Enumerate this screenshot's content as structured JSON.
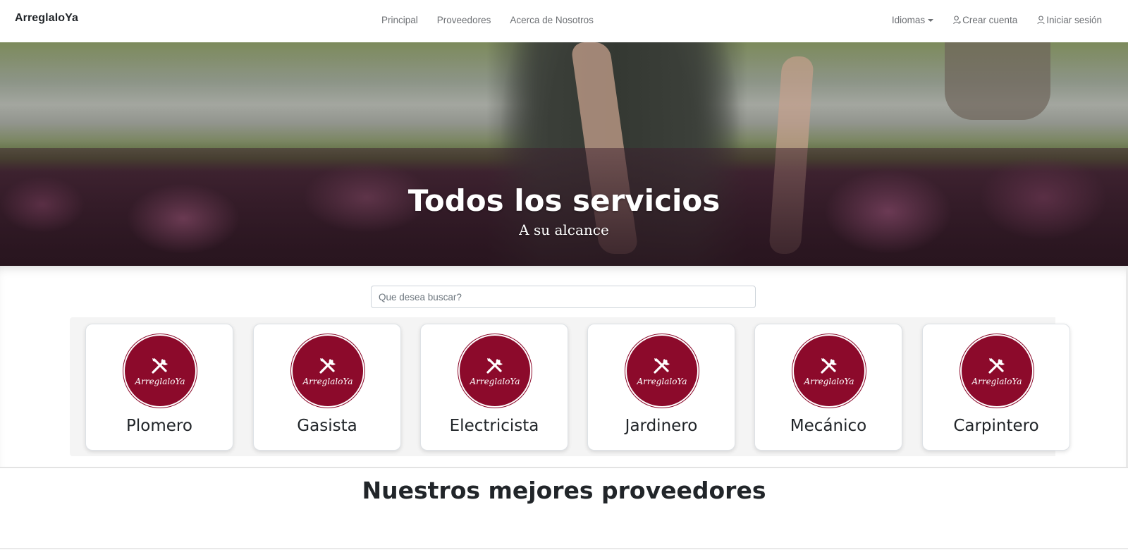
{
  "navbar": {
    "brand": "ArreglaloYa",
    "links": [
      "Principal",
      "Proveedores",
      "Acerca de Nosotros"
    ],
    "languages_label": "Idiomas",
    "create_account_label": "Crear cuenta",
    "login_label": "Iniciar sesión"
  },
  "hero": {
    "title": "Todos los servicios",
    "subtitle": "A su alcance"
  },
  "search": {
    "placeholder": "Que desea buscar?"
  },
  "categories": {
    "logo_text": "ArreglaloYa",
    "logo_color": "#8c0a2b",
    "items": [
      {
        "name": "Plomero"
      },
      {
        "name": "Gasista"
      },
      {
        "name": "Electricista"
      },
      {
        "name": "Jardinero"
      },
      {
        "name": "Mecánico"
      },
      {
        "name": "Carpintero"
      }
    ]
  },
  "section": {
    "title": "Nuestros mejores proveedores"
  }
}
